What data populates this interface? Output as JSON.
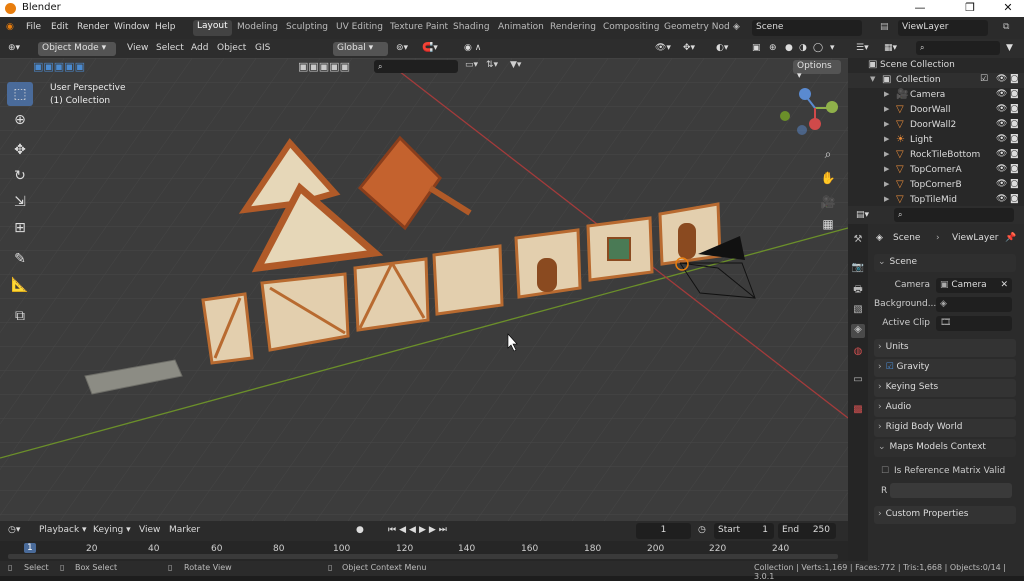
{
  "window": {
    "title": "Blender",
    "controls": {
      "minimize": "—",
      "maximize": "❐",
      "close": "✕"
    }
  },
  "menu": {
    "items": [
      "File",
      "Edit",
      "Render",
      "Window",
      "Help"
    ]
  },
  "workspaces": {
    "tabs": [
      "Layout",
      "Modeling",
      "Sculpting",
      "UV Editing",
      "Texture Paint",
      "Shading",
      "Animation",
      "Rendering",
      "Compositing",
      "Geometry Nod"
    ],
    "active": "Layout"
  },
  "scene_field": "Scene",
  "viewlayer_field": "ViewLayer",
  "header3d": {
    "mode": "Object Mode",
    "menus": [
      "View",
      "Select",
      "Add",
      "Object",
      "GIS"
    ],
    "transform": "Global",
    "options": "Options"
  },
  "viewport": {
    "view_name": "User Perspective",
    "collection_label": "(1) Collection"
  },
  "timeline": {
    "menus": [
      "Playback",
      "Keying",
      "View",
      "Marker"
    ],
    "current_frame": "1",
    "start_label": "Start",
    "start_value": "1",
    "end_label": "End",
    "end_value": "250"
  },
  "ruler": {
    "ticks": [
      "20",
      "40",
      "60",
      "80",
      "100",
      "120",
      "140",
      "160",
      "180",
      "200",
      "220",
      "240"
    ],
    "current": "1"
  },
  "status": {
    "select": "Select",
    "box_select": "Box Select",
    "rotate_view": "Rotate View",
    "context_menu": "Object Context Menu",
    "stats": "Collection | Verts:1,169 | Faces:772 | Tris:1,668 | Objects:0/14 | 3.0.1"
  },
  "outliner": {
    "scene_collection": "Scene Collection",
    "collection": "Collection",
    "items": [
      "Camera",
      "DoorWall",
      "DoorWall2",
      "Light",
      "RockTileBottom",
      "TopCornerA",
      "TopCornerB",
      "TopTileMid"
    ]
  },
  "properties": {
    "breadcrumb_scene": "Scene",
    "breadcrumb_viewlayer": "ViewLayer",
    "scene_section": "Scene",
    "camera_label": "Camera",
    "camera_value": "Camera",
    "background_label": "Background...",
    "active_clip_label": "Active Clip",
    "sections": [
      "Units",
      "Gravity",
      "Keying Sets",
      "Audio",
      "Rigid Body World",
      "Maps Models Context"
    ],
    "is_reference_label": "Is Reference Matrix Valid",
    "r_label": "R",
    "custom_props": "Custom Properties"
  },
  "colors": {
    "accent": "#4a6b9a",
    "grid_bg": "#3c3c3c",
    "x_axis": "#a33b3b",
    "y_axis": "#6b8f2a",
    "object_orange": "#e88b3a"
  }
}
